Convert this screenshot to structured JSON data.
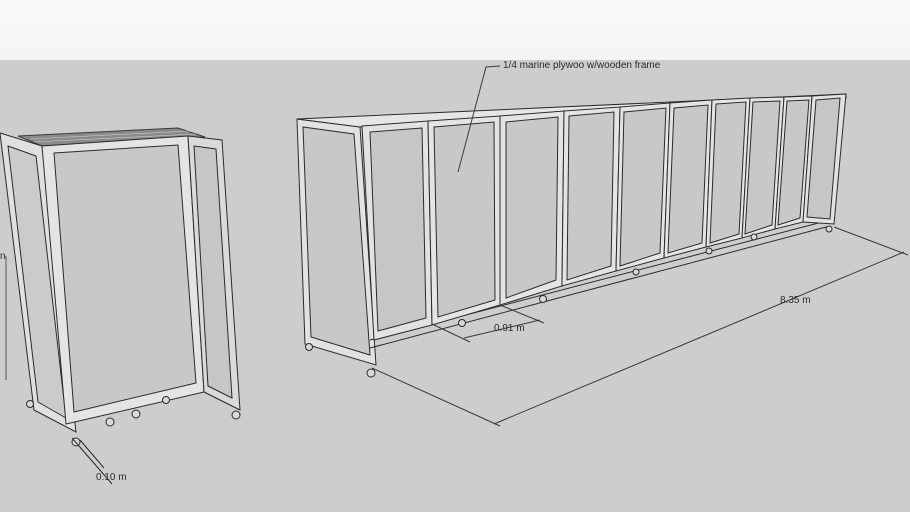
{
  "labels": {
    "material_note": "1/4 marine plywoo w/wooden frame",
    "panel_width": "0.91 m",
    "total_length": "8.35 m",
    "depth": "0.10 m",
    "cut_height": "n"
  },
  "colors": {
    "sky": "#f3f4f4",
    "ground": "#cdcdcd",
    "panel_fill": "#c8c8c8",
    "frame_face": "#e4e4e4",
    "line": "#2b2b2b"
  }
}
